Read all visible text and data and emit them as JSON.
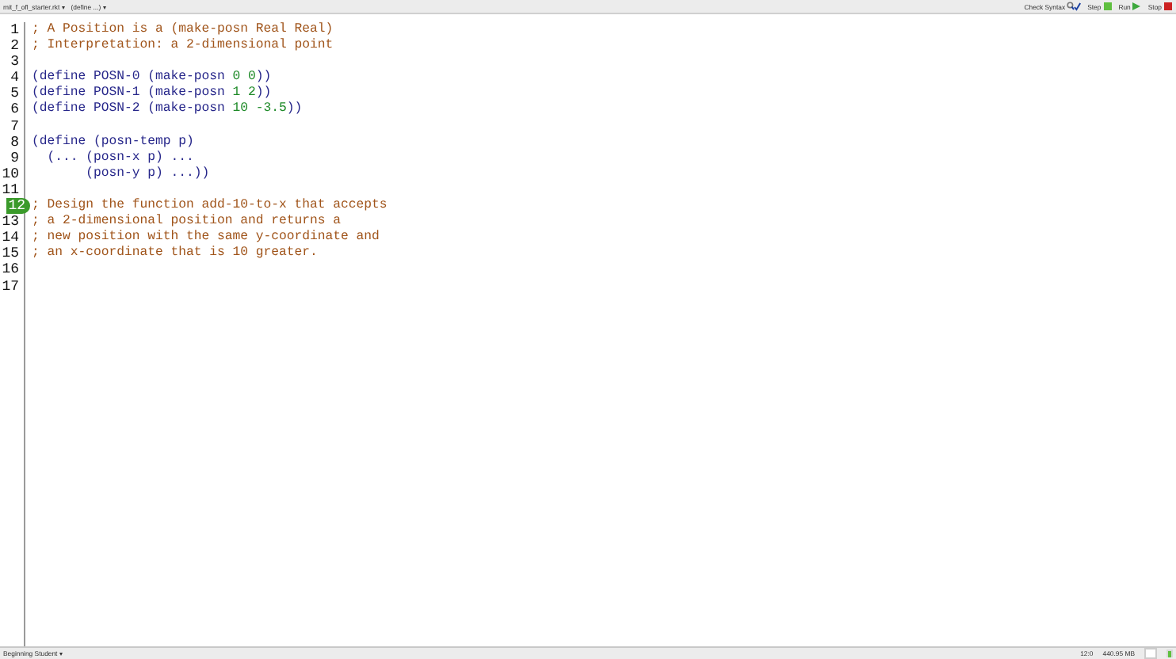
{
  "toolbar": {
    "file_menu": "mit_f_ofl_starter.rkt ▾",
    "define_menu": "(define ...) ▾",
    "buttons": [
      {
        "kind": "check",
        "label": "Check Syntax"
      },
      {
        "kind": "step",
        "label": "Step"
      },
      {
        "kind": "run",
        "label": "Run"
      },
      {
        "kind": "stop",
        "label": "Stop"
      }
    ]
  },
  "editor": {
    "lines": [
      {
        "number": "1",
        "current": false,
        "segments": [
          {
            "kind": "comment",
            "text": "; A Position is a (make-posn Real Real)"
          }
        ]
      },
      {
        "number": "2",
        "current": false,
        "segments": [
          {
            "kind": "comment",
            "text": "; Interpretation: a 2-dimensional point"
          }
        ]
      },
      {
        "number": "3",
        "current": false
      },
      {
        "number": "4",
        "current": false,
        "segments": [
          {
            "kind": "code",
            "text": "(define POSN-0 (make-posn "
          },
          {
            "kind": "number",
            "text": "0 0"
          },
          {
            "kind": "code",
            "text": "))"
          }
        ]
      },
      {
        "number": "5",
        "current": false,
        "segments": [
          {
            "kind": "code",
            "text": "(define POSN-1 (make-posn "
          },
          {
            "kind": "number",
            "text": "1 2"
          },
          {
            "kind": "code",
            "text": "))"
          }
        ]
      },
      {
        "number": "6",
        "current": false,
        "segments": [
          {
            "kind": "code",
            "text": "(define POSN-2 (make-posn "
          },
          {
            "kind": "number",
            "text": "10 -3.5"
          },
          {
            "kind": "code",
            "text": "))"
          }
        ]
      },
      {
        "number": "7",
        "current": false
      },
      {
        "number": "8",
        "current": false,
        "segments": [
          {
            "kind": "code",
            "text": "(define (posn-temp p)"
          }
        ]
      },
      {
        "number": "9",
        "current": false,
        "segments": [
          {
            "kind": "code",
            "text": "  (... (posn-x p) ..."
          }
        ]
      },
      {
        "number": "10",
        "current": false,
        "segments": [
          {
            "kind": "code",
            "text": "       (posn-y p) ...))"
          }
        ]
      },
      {
        "number": "11",
        "current": false
      },
      {
        "number": "12",
        "current": true,
        "segments": [
          {
            "kind": "comment",
            "text": "; Design the function add-10-to-x that accepts"
          }
        ]
      },
      {
        "number": "13",
        "current": false,
        "segments": [
          {
            "kind": "comment",
            "text": "; a 2-dimensional position and returns a"
          }
        ]
      },
      {
        "number": "14",
        "current": false,
        "segments": [
          {
            "kind": "comment",
            "text": "; new position with the same y-coordinate and"
          }
        ]
      },
      {
        "number": "15",
        "current": false,
        "segments": [
          {
            "kind": "comment",
            "text": "; an x-coordinate that is 10 greater."
          }
        ]
      },
      {
        "number": "16",
        "current": false
      },
      {
        "number": "17",
        "current": false
      }
    ]
  },
  "status_bar": {
    "language": "Beginning Student ▾",
    "position": "12:0",
    "memory": "440.95 MB"
  }
}
